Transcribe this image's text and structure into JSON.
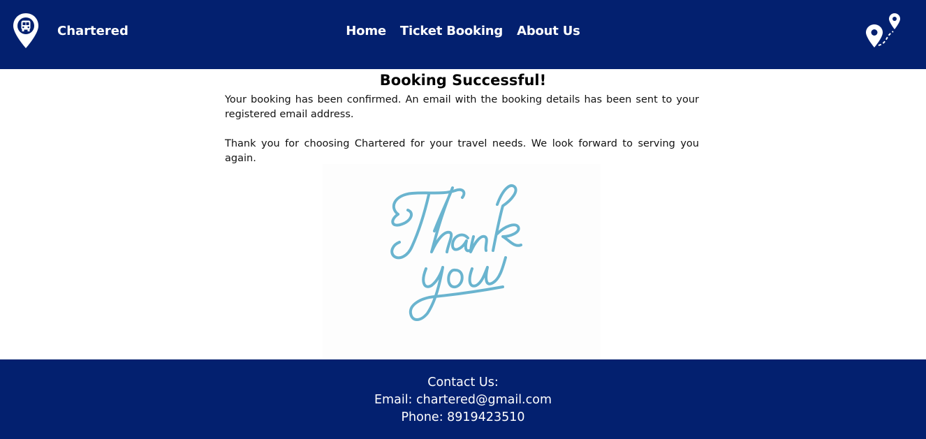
{
  "header": {
    "brand_name": "Chartered",
    "brand_icon": "bus-location-pin-icon",
    "route_icon": "route-pins-icon",
    "nav": [
      {
        "label": "Home"
      },
      {
        "label": "Ticket Booking"
      },
      {
        "label": "About Us"
      }
    ]
  },
  "main": {
    "title": "Booking Successful!",
    "paragraph1": "Your booking has been confirmed. An email with the booking details has been sent to your registered email address.",
    "paragraph2": "Thank you for choosing Chartered for your travel needs. We look forward to serving you again.",
    "image": {
      "line1": "Thank",
      "line2": "you",
      "color": "#6ab4cf"
    }
  },
  "footer": {
    "heading": "Contact Us:",
    "email": "Email: chartered@gmail.com",
    "phone": "Phone: 8919423510"
  },
  "colors": {
    "nav_bg": "#03206f",
    "text_on_dark": "#ffffff"
  }
}
